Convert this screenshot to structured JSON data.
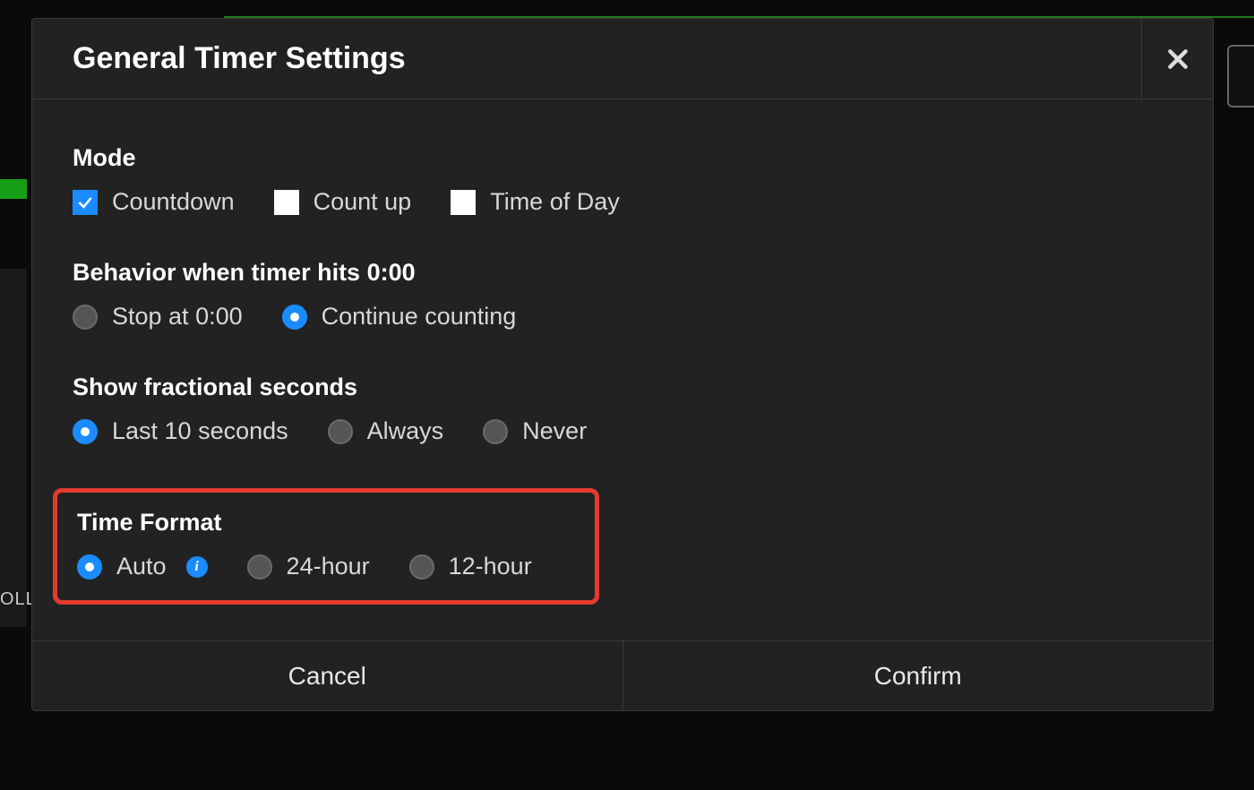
{
  "modal": {
    "title": "General Timer Settings",
    "sections": {
      "mode": {
        "label": "Mode",
        "options": [
          {
            "label": "Countdown",
            "checked": true
          },
          {
            "label": "Count up",
            "checked": false
          },
          {
            "label": "Time of Day",
            "checked": false
          }
        ]
      },
      "behavior": {
        "label": "Behavior when timer hits 0:00",
        "options": [
          {
            "label": "Stop at 0:00",
            "selected": false
          },
          {
            "label": "Continue counting",
            "selected": true
          }
        ]
      },
      "fractional": {
        "label": "Show fractional seconds",
        "options": [
          {
            "label": "Last 10 seconds",
            "selected": true
          },
          {
            "label": "Always",
            "selected": false
          },
          {
            "label": "Never",
            "selected": false
          }
        ]
      },
      "timeformat": {
        "label": "Time Format",
        "options": [
          {
            "label": "Auto",
            "selected": true,
            "info": true
          },
          {
            "label": "24-hour",
            "selected": false
          },
          {
            "label": "12-hour",
            "selected": false
          }
        ]
      }
    },
    "footer": {
      "cancel": "Cancel",
      "confirm": "Confirm"
    }
  },
  "bg": {
    "oll": "OLL"
  },
  "colors": {
    "accent": "#1a8cff",
    "highlight": "#e43b2f"
  }
}
